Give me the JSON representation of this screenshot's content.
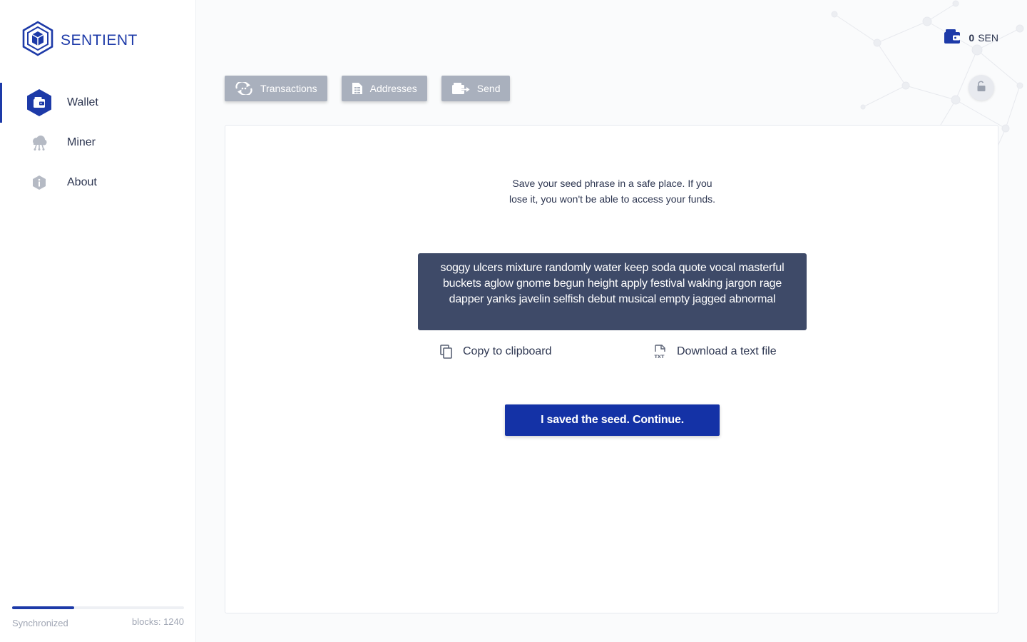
{
  "app": {
    "name": "SENTIENT"
  },
  "colors": {
    "brand": "#1d3aa8",
    "button_primary": "#1432a6",
    "toolbar_button": "#a9b0bd",
    "seed_box": "#3e4a68"
  },
  "sidebar": {
    "items": [
      {
        "label": "Wallet",
        "icon": "wallet-icon",
        "active": true
      },
      {
        "label": "Miner",
        "icon": "miner-cloud-icon",
        "active": false
      },
      {
        "label": "About",
        "icon": "info-icon",
        "active": false
      }
    ],
    "sync": {
      "status": "Synchronized",
      "blocks": "blocks: 1240",
      "progress": 0.36
    }
  },
  "header": {
    "balance": {
      "amount": "0",
      "unit": "SEN",
      "icon": "wallet-icon"
    },
    "lock_icon": "lock-open-icon"
  },
  "toolbar": {
    "transactions": "Transactions",
    "addresses": "Addresses",
    "send": "Send"
  },
  "seed": {
    "instructions_line1": "Save your seed phrase in a safe place. If you",
    "instructions_line2": "lose it, you won't be able to access your funds.",
    "phrase": "soggy ulcers mixture randomly water keep soda quote vocal masterful buckets aglow gnome begun height apply festival waking jargon rage dapper yanks javelin selfish debut musical empty jagged abnormal",
    "copy_label": "Copy to clipboard",
    "download_label": "Download a text file",
    "continue_label": "I saved the seed. Continue."
  }
}
